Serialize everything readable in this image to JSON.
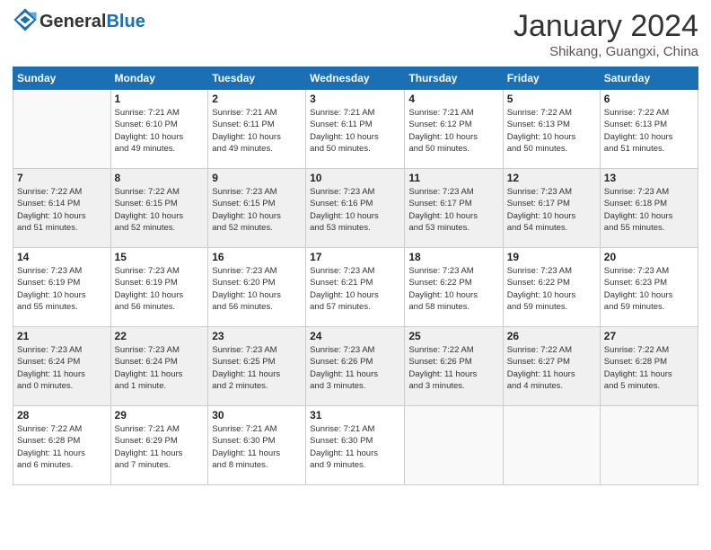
{
  "logo": {
    "text_general": "General",
    "text_blue": "Blue"
  },
  "title": "January 2024",
  "subtitle": "Shikang, Guangxi, China",
  "weekdays": [
    "Sunday",
    "Monday",
    "Tuesday",
    "Wednesday",
    "Thursday",
    "Friday",
    "Saturday"
  ],
  "weeks": [
    [
      {
        "num": "",
        "info": ""
      },
      {
        "num": "1",
        "info": "Sunrise: 7:21 AM\nSunset: 6:10 PM\nDaylight: 10 hours\nand 49 minutes."
      },
      {
        "num": "2",
        "info": "Sunrise: 7:21 AM\nSunset: 6:11 PM\nDaylight: 10 hours\nand 49 minutes."
      },
      {
        "num": "3",
        "info": "Sunrise: 7:21 AM\nSunset: 6:11 PM\nDaylight: 10 hours\nand 50 minutes."
      },
      {
        "num": "4",
        "info": "Sunrise: 7:21 AM\nSunset: 6:12 PM\nDaylight: 10 hours\nand 50 minutes."
      },
      {
        "num": "5",
        "info": "Sunrise: 7:22 AM\nSunset: 6:13 PM\nDaylight: 10 hours\nand 50 minutes."
      },
      {
        "num": "6",
        "info": "Sunrise: 7:22 AM\nSunset: 6:13 PM\nDaylight: 10 hours\nand 51 minutes."
      }
    ],
    [
      {
        "num": "7",
        "info": "Sunrise: 7:22 AM\nSunset: 6:14 PM\nDaylight: 10 hours\nand 51 minutes."
      },
      {
        "num": "8",
        "info": "Sunrise: 7:22 AM\nSunset: 6:15 PM\nDaylight: 10 hours\nand 52 minutes."
      },
      {
        "num": "9",
        "info": "Sunrise: 7:23 AM\nSunset: 6:15 PM\nDaylight: 10 hours\nand 52 minutes."
      },
      {
        "num": "10",
        "info": "Sunrise: 7:23 AM\nSunset: 6:16 PM\nDaylight: 10 hours\nand 53 minutes."
      },
      {
        "num": "11",
        "info": "Sunrise: 7:23 AM\nSunset: 6:17 PM\nDaylight: 10 hours\nand 53 minutes."
      },
      {
        "num": "12",
        "info": "Sunrise: 7:23 AM\nSunset: 6:17 PM\nDaylight: 10 hours\nand 54 minutes."
      },
      {
        "num": "13",
        "info": "Sunrise: 7:23 AM\nSunset: 6:18 PM\nDaylight: 10 hours\nand 55 minutes."
      }
    ],
    [
      {
        "num": "14",
        "info": "Sunrise: 7:23 AM\nSunset: 6:19 PM\nDaylight: 10 hours\nand 55 minutes."
      },
      {
        "num": "15",
        "info": "Sunrise: 7:23 AM\nSunset: 6:19 PM\nDaylight: 10 hours\nand 56 minutes."
      },
      {
        "num": "16",
        "info": "Sunrise: 7:23 AM\nSunset: 6:20 PM\nDaylight: 10 hours\nand 56 minutes."
      },
      {
        "num": "17",
        "info": "Sunrise: 7:23 AM\nSunset: 6:21 PM\nDaylight: 10 hours\nand 57 minutes."
      },
      {
        "num": "18",
        "info": "Sunrise: 7:23 AM\nSunset: 6:22 PM\nDaylight: 10 hours\nand 58 minutes."
      },
      {
        "num": "19",
        "info": "Sunrise: 7:23 AM\nSunset: 6:22 PM\nDaylight: 10 hours\nand 59 minutes."
      },
      {
        "num": "20",
        "info": "Sunrise: 7:23 AM\nSunset: 6:23 PM\nDaylight: 10 hours\nand 59 minutes."
      }
    ],
    [
      {
        "num": "21",
        "info": "Sunrise: 7:23 AM\nSunset: 6:24 PM\nDaylight: 11 hours\nand 0 minutes."
      },
      {
        "num": "22",
        "info": "Sunrise: 7:23 AM\nSunset: 6:24 PM\nDaylight: 11 hours\nand 1 minute."
      },
      {
        "num": "23",
        "info": "Sunrise: 7:23 AM\nSunset: 6:25 PM\nDaylight: 11 hours\nand 2 minutes."
      },
      {
        "num": "24",
        "info": "Sunrise: 7:23 AM\nSunset: 6:26 PM\nDaylight: 11 hours\nand 3 minutes."
      },
      {
        "num": "25",
        "info": "Sunrise: 7:22 AM\nSunset: 6:26 PM\nDaylight: 11 hours\nand 3 minutes."
      },
      {
        "num": "26",
        "info": "Sunrise: 7:22 AM\nSunset: 6:27 PM\nDaylight: 11 hours\nand 4 minutes."
      },
      {
        "num": "27",
        "info": "Sunrise: 7:22 AM\nSunset: 6:28 PM\nDaylight: 11 hours\nand 5 minutes."
      }
    ],
    [
      {
        "num": "28",
        "info": "Sunrise: 7:22 AM\nSunset: 6:28 PM\nDaylight: 11 hours\nand 6 minutes."
      },
      {
        "num": "29",
        "info": "Sunrise: 7:21 AM\nSunset: 6:29 PM\nDaylight: 11 hours\nand 7 minutes."
      },
      {
        "num": "30",
        "info": "Sunrise: 7:21 AM\nSunset: 6:30 PM\nDaylight: 11 hours\nand 8 minutes."
      },
      {
        "num": "31",
        "info": "Sunrise: 7:21 AM\nSunset: 6:30 PM\nDaylight: 11 hours\nand 9 minutes."
      },
      {
        "num": "",
        "info": ""
      },
      {
        "num": "",
        "info": ""
      },
      {
        "num": "",
        "info": ""
      }
    ]
  ]
}
